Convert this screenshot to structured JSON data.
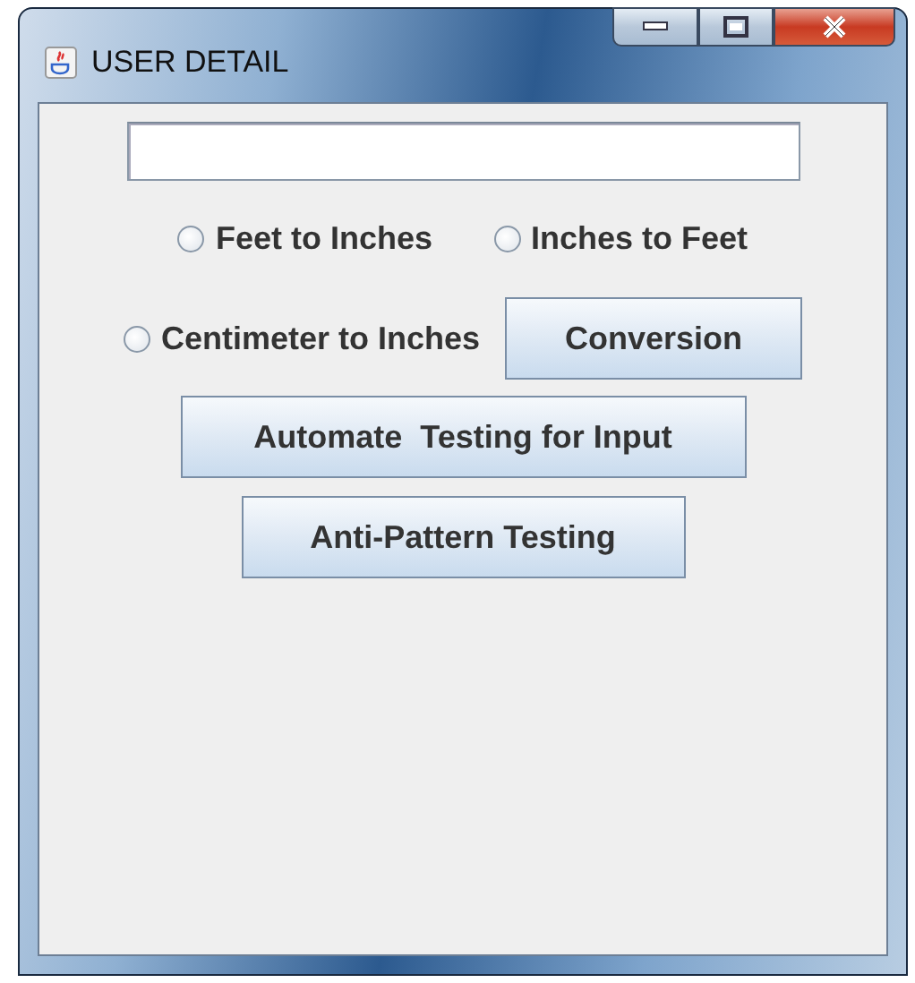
{
  "window": {
    "title": "USER DETAIL"
  },
  "radios": [
    {
      "label": "Feet to Inches",
      "selected": false
    },
    {
      "label": "Inches to Feet",
      "selected": false
    },
    {
      "label": "Centimeter to Inches",
      "selected": false
    }
  ],
  "buttons": [
    "Conversion",
    "Automate  Testing for Input",
    "Anti-Pattern Testing"
  ]
}
